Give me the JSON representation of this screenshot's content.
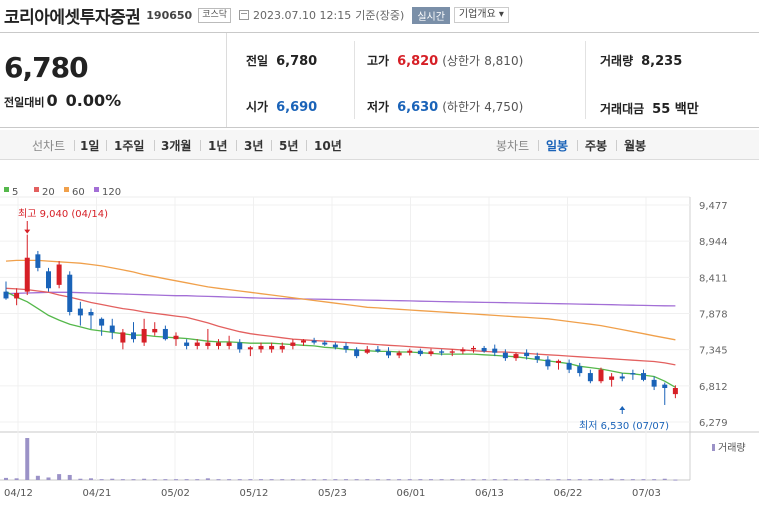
{
  "header": {
    "company": "코리아에셋투자증권",
    "code": "190650",
    "market": "코스닥",
    "datetime": "2023.07.10 12:15",
    "basis": "기준(장중)",
    "realtime_label": "실시간",
    "company_info_label": "기업개요"
  },
  "summary": {
    "price": "6,780",
    "change_label": "전일대비",
    "change_value": "0",
    "change_pct": "0.00%",
    "prev_close_label": "전일",
    "prev_close": "6,780",
    "high_label": "고가",
    "high": "6,820",
    "upper_limit_label": "(상한가",
    "upper_limit": "8,810)",
    "volume_label": "거래량",
    "volume": "8,235",
    "open_label": "시가",
    "open": "6,690",
    "low_label": "저가",
    "low": "6,630",
    "lower_limit_label": "(하한가",
    "lower_limit": "4,750)",
    "amount_label": "거래대금",
    "amount": "55 백만",
    "colors": {
      "up": "#d61f26",
      "down": "#1a63b8"
    }
  },
  "tabs": {
    "line_label": "선차트",
    "periods": [
      "1일",
      "1주일",
      "3개월",
      "1년",
      "3년",
      "5년",
      "10년"
    ],
    "candle_label": "봉차트",
    "candle_types": [
      "일봉",
      "주봉",
      "월봉"
    ],
    "selected_candle": "일봉"
  },
  "chart_data": {
    "type": "candlestick",
    "legend": [
      {
        "name": "5",
        "color": "#55b84b"
      },
      {
        "name": "20",
        "color": "#e3605f"
      },
      {
        "name": "60",
        "color": "#f0a04b"
      },
      {
        "name": "120",
        "color": "#a36fd6"
      }
    ],
    "y_ticks": [
      9477,
      8944,
      8411,
      7878,
      7345,
      6812,
      6279
    ],
    "ylim": [
      6279,
      9477
    ],
    "x_ticks": [
      "04/12",
      "04/21",
      "05/02",
      "05/12",
      "05/23",
      "06/01",
      "06/13",
      "06/22",
      "07/03"
    ],
    "max_annotation": {
      "label": "최고 9,040 (04/14)",
      "value": 9040,
      "index": 2
    },
    "min_annotation": {
      "label": "최저 6,530 (07/07)",
      "value": 6530,
      "index": 58
    },
    "volume_label": "거래량",
    "candles": [
      {
        "o": 8200,
        "h": 8350,
        "l": 8080,
        "c": 8100
      },
      {
        "o": 8100,
        "h": 8250,
        "l": 8000,
        "c": 8180
      },
      {
        "o": 8200,
        "h": 9040,
        "l": 8150,
        "c": 8700
      },
      {
        "o": 8750,
        "h": 8800,
        "l": 8500,
        "c": 8550
      },
      {
        "o": 8500,
        "h": 8550,
        "l": 8200,
        "c": 8250
      },
      {
        "o": 8300,
        "h": 8650,
        "l": 8250,
        "c": 8600
      },
      {
        "o": 8450,
        "h": 8500,
        "l": 7850,
        "c": 7900
      },
      {
        "o": 7950,
        "h": 8050,
        "l": 7700,
        "c": 7850
      },
      {
        "o": 7900,
        "h": 7950,
        "l": 7650,
        "c": 7850
      },
      {
        "o": 7800,
        "h": 7820,
        "l": 7550,
        "c": 7700
      },
      {
        "o": 7700,
        "h": 7800,
        "l": 7500,
        "c": 7600
      },
      {
        "o": 7450,
        "h": 7650,
        "l": 7350,
        "c": 7600
      },
      {
        "o": 7600,
        "h": 7750,
        "l": 7450,
        "c": 7500
      },
      {
        "o": 7450,
        "h": 7800,
        "l": 7400,
        "c": 7650
      },
      {
        "o": 7600,
        "h": 7750,
        "l": 7550,
        "c": 7650
      },
      {
        "o": 7650,
        "h": 7700,
        "l": 7480,
        "c": 7500
      },
      {
        "o": 7500,
        "h": 7600,
        "l": 7400,
        "c": 7550
      },
      {
        "o": 7450,
        "h": 7500,
        "l": 7350,
        "c": 7400
      },
      {
        "o": 7400,
        "h": 7500,
        "l": 7350,
        "c": 7450
      },
      {
        "o": 7400,
        "h": 7650,
        "l": 7350,
        "c": 7450
      },
      {
        "o": 7400,
        "h": 7500,
        "l": 7350,
        "c": 7450
      },
      {
        "o": 7400,
        "h": 7550,
        "l": 7350,
        "c": 7450
      },
      {
        "o": 7450,
        "h": 7500,
        "l": 7300,
        "c": 7350
      },
      {
        "o": 7350,
        "h": 7400,
        "l": 7250,
        "c": 7380
      },
      {
        "o": 7350,
        "h": 7450,
        "l": 7300,
        "c": 7400
      },
      {
        "o": 7350,
        "h": 7450,
        "l": 7300,
        "c": 7400
      },
      {
        "o": 7350,
        "h": 7450,
        "l": 7300,
        "c": 7400
      },
      {
        "o": 7400,
        "h": 7500,
        "l": 7350,
        "c": 7450
      },
      {
        "o": 7450,
        "h": 7500,
        "l": 7400,
        "c": 7480
      },
      {
        "o": 7480,
        "h": 7520,
        "l": 7420,
        "c": 7450
      },
      {
        "o": 7450,
        "h": 7480,
        "l": 7400,
        "c": 7420
      },
      {
        "o": 7420,
        "h": 7450,
        "l": 7350,
        "c": 7380
      },
      {
        "o": 7400,
        "h": 7450,
        "l": 7300,
        "c": 7350
      },
      {
        "o": 7350,
        "h": 7380,
        "l": 7220,
        "c": 7250
      },
      {
        "o": 7300,
        "h": 7400,
        "l": 7280,
        "c": 7350
      },
      {
        "o": 7350,
        "h": 7400,
        "l": 7300,
        "c": 7320
      },
      {
        "o": 7320,
        "h": 7380,
        "l": 7220,
        "c": 7260
      },
      {
        "o": 7260,
        "h": 7330,
        "l": 7220,
        "c": 7300
      },
      {
        "o": 7300,
        "h": 7360,
        "l": 7260,
        "c": 7330
      },
      {
        "o": 7330,
        "h": 7360,
        "l": 7250,
        "c": 7280
      },
      {
        "o": 7280,
        "h": 7360,
        "l": 7250,
        "c": 7320
      },
      {
        "o": 7320,
        "h": 7350,
        "l": 7260,
        "c": 7300
      },
      {
        "o": 7300,
        "h": 7350,
        "l": 7250,
        "c": 7320
      },
      {
        "o": 7320,
        "h": 7380,
        "l": 7280,
        "c": 7350
      },
      {
        "o": 7350,
        "h": 7400,
        "l": 7300,
        "c": 7370
      },
      {
        "o": 7370,
        "h": 7400,
        "l": 7300,
        "c": 7320
      },
      {
        "o": 7360,
        "h": 7420,
        "l": 7250,
        "c": 7300
      },
      {
        "o": 7300,
        "h": 7350,
        "l": 7180,
        "c": 7220
      },
      {
        "o": 7220,
        "h": 7300,
        "l": 7180,
        "c": 7280
      },
      {
        "o": 7300,
        "h": 7350,
        "l": 7200,
        "c": 7250
      },
      {
        "o": 7250,
        "h": 7300,
        "l": 7150,
        "c": 7200
      },
      {
        "o": 7200,
        "h": 7250,
        "l": 7050,
        "c": 7100
      },
      {
        "o": 7150,
        "h": 7200,
        "l": 7050,
        "c": 7180
      },
      {
        "o": 7150,
        "h": 7200,
        "l": 7000,
        "c": 7050
      },
      {
        "o": 7100,
        "h": 7150,
        "l": 6950,
        "c": 7000
      },
      {
        "o": 7000,
        "h": 7050,
        "l": 6850,
        "c": 6880
      },
      {
        "o": 6880,
        "h": 7080,
        "l": 6850,
        "c": 7050
      },
      {
        "o": 6900,
        "h": 7000,
        "l": 6800,
        "c": 6950
      },
      {
        "o": 6950,
        "h": 7000,
        "l": 6880,
        "c": 6920
      },
      {
        "o": 7000,
        "h": 7050,
        "l": 6900,
        "c": 6980
      },
      {
        "o": 7000,
        "h": 7050,
        "l": 6880,
        "c": 6900
      },
      {
        "o": 6900,
        "h": 6950,
        "l": 6750,
        "c": 6800
      },
      {
        "o": 6830,
        "h": 6860,
        "l": 6530,
        "c": 6780
      },
      {
        "o": 6690,
        "h": 6820,
        "l": 6630,
        "c": 6780
      }
    ],
    "ma5": [
      8200,
      8120,
      8050,
      7950,
      7850,
      7780,
      7720,
      7680,
      7640,
      7620,
      7600,
      7580,
      7560,
      7560,
      7540,
      7530,
      7520,
      7510,
      7490,
      7470,
      7460,
      7460,
      7450,
      7440,
      7440,
      7440,
      7430,
      7420,
      7410,
      7400,
      7380,
      7370,
      7350,
      7340,
      7330,
      7320,
      7320,
      7310,
      7310,
      7300,
      7290,
      7280,
      7280,
      7280,
      7280,
      7270,
      7260,
      7250,
      7240,
      7220,
      7200,
      7180,
      7160,
      7140,
      7100,
      7080,
      7060,
      7030,
      7000,
      6990,
      6970,
      6950,
      6880,
      6790
    ],
    "ma20": [
      8250,
      8240,
      8230,
      8210,
      8190,
      8150,
      8120,
      8080,
      8040,
      8010,
      7980,
      7950,
      7930,
      7900,
      7880,
      7860,
      7840,
      7820,
      7780,
      7740,
      7690,
      7650,
      7610,
      7580,
      7560,
      7540,
      7520,
      7500,
      7490,
      7480,
      7470,
      7460,
      7450,
      7440,
      7430,
      7420,
      7410,
      7400,
      7390,
      7380,
      7370,
      7360,
      7350,
      7340,
      7330,
      7320,
      7310,
      7310,
      7300,
      7290,
      7280,
      7270,
      7260,
      7250,
      7240,
      7230,
      7220,
      7210,
      7200,
      7190,
      7180,
      7170,
      7150,
      7120
    ],
    "ma60": [
      8650,
      8660,
      8660,
      8660,
      8650,
      8640,
      8630,
      8620,
      8600,
      8580,
      8550,
      8520,
      8490,
      8450,
      8420,
      8390,
      8360,
      8330,
      8300,
      8270,
      8250,
      8230,
      8210,
      8190,
      8170,
      8150,
      8130,
      8110,
      8090,
      8070,
      8050,
      8030,
      8010,
      7990,
      7970,
      7960,
      7950,
      7940,
      7930,
      7920,
      7910,
      7900,
      7890,
      7880,
      7870,
      7860,
      7850,
      7840,
      7830,
      7820,
      7810,
      7800,
      7780,
      7760,
      7740,
      7720,
      7700,
      7670,
      7640,
      7610,
      7580,
      7550,
      7520,
      7490
    ],
    "ma120": [
      8170,
      8175,
      8180,
      8185,
      8190,
      8190,
      8190,
      8185,
      8180,
      8175,
      8170,
      8165,
      8160,
      8155,
      8150,
      8145,
      8140,
      8140,
      8135,
      8130,
      8125,
      8120,
      8115,
      8110,
      8105,
      8100,
      8098,
      8095,
      8092,
      8090,
      8087,
      8084,
      8081,
      8078,
      8075,
      8072,
      8069,
      8066,
      8063,
      8060,
      8057,
      8054,
      8051,
      8048,
      8045,
      8042,
      8040,
      8037,
      8034,
      8031,
      8028,
      8025,
      8022,
      8019,
      8016,
      8013,
      8010,
      8007,
      8004,
      8001,
      7998,
      7995,
      7992,
      7990
    ],
    "volume": [
      5,
      4,
      100,
      10,
      6,
      14,
      12,
      3,
      4,
      2,
      3,
      2,
      2,
      3,
      2,
      2,
      2,
      2,
      2,
      4,
      2,
      2,
      2,
      2,
      2,
      2,
      2,
      2,
      2,
      2,
      2,
      2,
      2,
      2,
      2,
      2,
      2,
      2,
      2,
      2,
      2,
      2,
      2,
      2,
      2,
      2,
      2,
      2,
      2,
      2,
      2,
      2,
      2,
      2,
      2,
      2,
      2,
      3,
      2,
      2,
      2,
      2,
      3,
      1
    ]
  }
}
